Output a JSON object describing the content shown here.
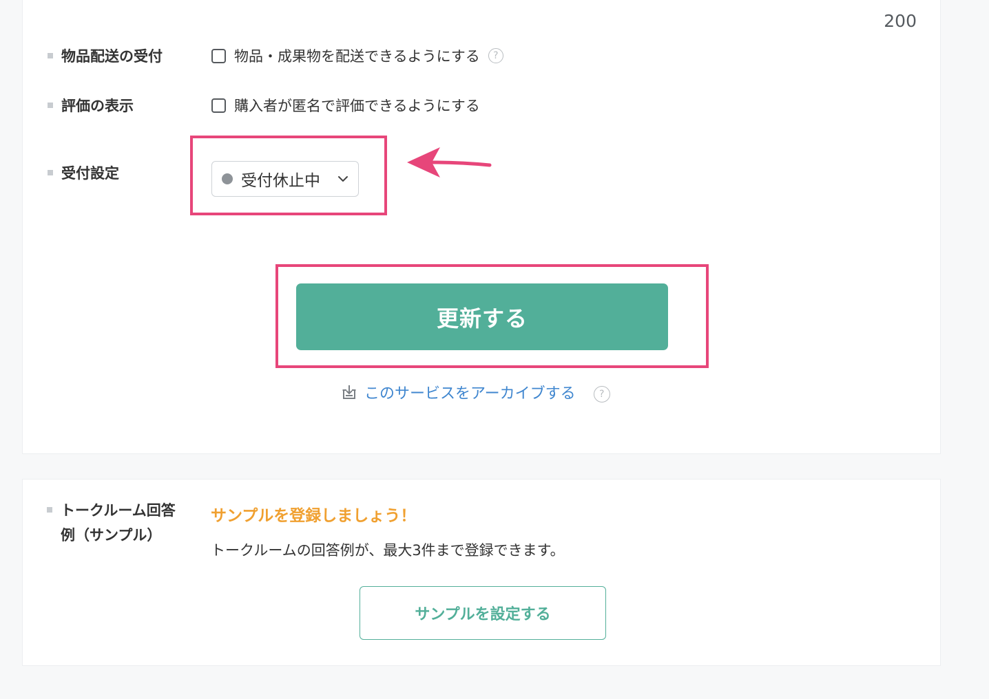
{
  "counter": "200",
  "delivery": {
    "label": "物品配送の受付",
    "checkbox_label": "物品・成果物を配送できるようにする",
    "help": "?"
  },
  "rating": {
    "label": "評価の表示",
    "checkbox_label": "購入者が匿名で評価できるようにする"
  },
  "reception": {
    "label": "受付設定",
    "selected": "受付休止中"
  },
  "actions": {
    "update_label": "更新する",
    "archive_label": "このサービスをアーカイブする",
    "help": "?"
  },
  "sample": {
    "label_line1": "トークルーム回答",
    "label_line2": "例（サンプル）",
    "prompt": "サンプルを登録しましょう！",
    "description": "トークルームの回答例が、最大3件まで登録できます。",
    "button_label": "サンプルを設定する"
  },
  "colors": {
    "accent_green": "#52af99",
    "highlight_pink": "#e7467a",
    "link_blue": "#3f86cf",
    "prompt_orange": "#f0a030",
    "status_gray": "#8e9398"
  }
}
